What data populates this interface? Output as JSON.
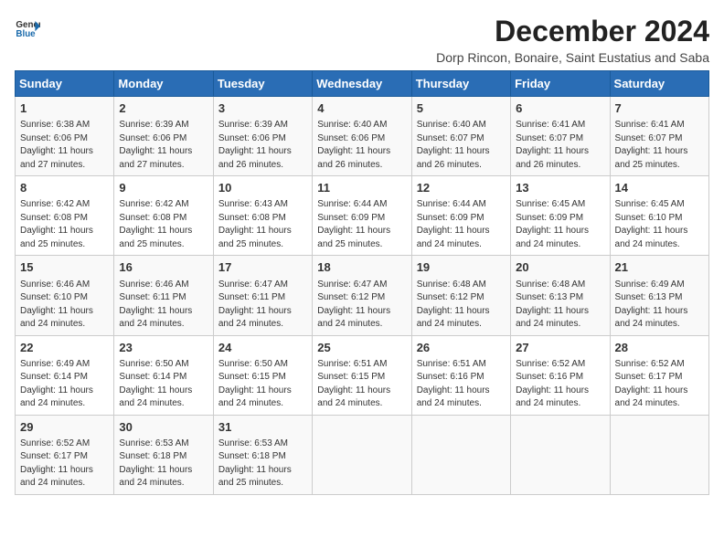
{
  "header": {
    "logo_general": "General",
    "logo_blue": "Blue",
    "title": "December 2024",
    "subtitle": "Dorp Rincon, Bonaire, Saint Eustatius and Saba"
  },
  "calendar": {
    "days_of_week": [
      "Sunday",
      "Monday",
      "Tuesday",
      "Wednesday",
      "Thursday",
      "Friday",
      "Saturday"
    ],
    "weeks": [
      [
        {
          "day": "1",
          "detail": "Sunrise: 6:38 AM\nSunset: 6:06 PM\nDaylight: 11 hours\nand 27 minutes."
        },
        {
          "day": "2",
          "detail": "Sunrise: 6:39 AM\nSunset: 6:06 PM\nDaylight: 11 hours\nand 27 minutes."
        },
        {
          "day": "3",
          "detail": "Sunrise: 6:39 AM\nSunset: 6:06 PM\nDaylight: 11 hours\nand 26 minutes."
        },
        {
          "day": "4",
          "detail": "Sunrise: 6:40 AM\nSunset: 6:06 PM\nDaylight: 11 hours\nand 26 minutes."
        },
        {
          "day": "5",
          "detail": "Sunrise: 6:40 AM\nSunset: 6:07 PM\nDaylight: 11 hours\nand 26 minutes."
        },
        {
          "day": "6",
          "detail": "Sunrise: 6:41 AM\nSunset: 6:07 PM\nDaylight: 11 hours\nand 26 minutes."
        },
        {
          "day": "7",
          "detail": "Sunrise: 6:41 AM\nSunset: 6:07 PM\nDaylight: 11 hours\nand 25 minutes."
        }
      ],
      [
        {
          "day": "8",
          "detail": "Sunrise: 6:42 AM\nSunset: 6:08 PM\nDaylight: 11 hours\nand 25 minutes."
        },
        {
          "day": "9",
          "detail": "Sunrise: 6:42 AM\nSunset: 6:08 PM\nDaylight: 11 hours\nand 25 minutes."
        },
        {
          "day": "10",
          "detail": "Sunrise: 6:43 AM\nSunset: 6:08 PM\nDaylight: 11 hours\nand 25 minutes."
        },
        {
          "day": "11",
          "detail": "Sunrise: 6:44 AM\nSunset: 6:09 PM\nDaylight: 11 hours\nand 25 minutes."
        },
        {
          "day": "12",
          "detail": "Sunrise: 6:44 AM\nSunset: 6:09 PM\nDaylight: 11 hours\nand 24 minutes."
        },
        {
          "day": "13",
          "detail": "Sunrise: 6:45 AM\nSunset: 6:09 PM\nDaylight: 11 hours\nand 24 minutes."
        },
        {
          "day": "14",
          "detail": "Sunrise: 6:45 AM\nSunset: 6:10 PM\nDaylight: 11 hours\nand 24 minutes."
        }
      ],
      [
        {
          "day": "15",
          "detail": "Sunrise: 6:46 AM\nSunset: 6:10 PM\nDaylight: 11 hours\nand 24 minutes."
        },
        {
          "day": "16",
          "detail": "Sunrise: 6:46 AM\nSunset: 6:11 PM\nDaylight: 11 hours\nand 24 minutes."
        },
        {
          "day": "17",
          "detail": "Sunrise: 6:47 AM\nSunset: 6:11 PM\nDaylight: 11 hours\nand 24 minutes."
        },
        {
          "day": "18",
          "detail": "Sunrise: 6:47 AM\nSunset: 6:12 PM\nDaylight: 11 hours\nand 24 minutes."
        },
        {
          "day": "19",
          "detail": "Sunrise: 6:48 AM\nSunset: 6:12 PM\nDaylight: 11 hours\nand 24 minutes."
        },
        {
          "day": "20",
          "detail": "Sunrise: 6:48 AM\nSunset: 6:13 PM\nDaylight: 11 hours\nand 24 minutes."
        },
        {
          "day": "21",
          "detail": "Sunrise: 6:49 AM\nSunset: 6:13 PM\nDaylight: 11 hours\nand 24 minutes."
        }
      ],
      [
        {
          "day": "22",
          "detail": "Sunrise: 6:49 AM\nSunset: 6:14 PM\nDaylight: 11 hours\nand 24 minutes."
        },
        {
          "day": "23",
          "detail": "Sunrise: 6:50 AM\nSunset: 6:14 PM\nDaylight: 11 hours\nand 24 minutes."
        },
        {
          "day": "24",
          "detail": "Sunrise: 6:50 AM\nSunset: 6:15 PM\nDaylight: 11 hours\nand 24 minutes."
        },
        {
          "day": "25",
          "detail": "Sunrise: 6:51 AM\nSunset: 6:15 PM\nDaylight: 11 hours\nand 24 minutes."
        },
        {
          "day": "26",
          "detail": "Sunrise: 6:51 AM\nSunset: 6:16 PM\nDaylight: 11 hours\nand 24 minutes."
        },
        {
          "day": "27",
          "detail": "Sunrise: 6:52 AM\nSunset: 6:16 PM\nDaylight: 11 hours\nand 24 minutes."
        },
        {
          "day": "28",
          "detail": "Sunrise: 6:52 AM\nSunset: 6:17 PM\nDaylight: 11 hours\nand 24 minutes."
        }
      ],
      [
        {
          "day": "29",
          "detail": "Sunrise: 6:52 AM\nSunset: 6:17 PM\nDaylight: 11 hours\nand 24 minutes."
        },
        {
          "day": "30",
          "detail": "Sunrise: 6:53 AM\nSunset: 6:18 PM\nDaylight: 11 hours\nand 24 minutes."
        },
        {
          "day": "31",
          "detail": "Sunrise: 6:53 AM\nSunset: 6:18 PM\nDaylight: 11 hours\nand 25 minutes."
        },
        null,
        null,
        null,
        null
      ]
    ]
  }
}
